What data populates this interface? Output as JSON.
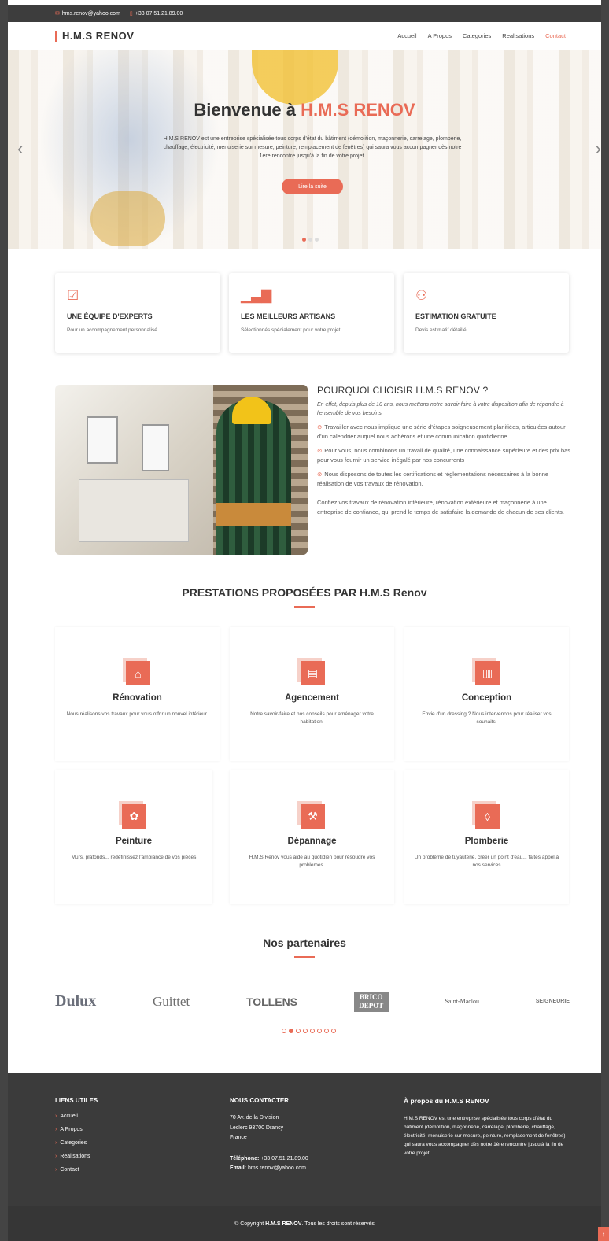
{
  "topbar": {
    "email": "hms.renov@yahoo.com",
    "phone": "+33 07.51.21.89.00"
  },
  "brand": {
    "name": "H.M.S RENOV",
    "accent": "#e96b56",
    "dark": "#3b3b3b"
  },
  "nav": {
    "items": [
      "Accueil",
      "A Propos",
      "Categories",
      "Realisations",
      "Contact"
    ],
    "active": "Contact"
  },
  "hero": {
    "title_prefix": "Bienvenue à",
    "title_accent": "H.M.S RENOV",
    "text": "H.M.S RENOV est une entreprise spécialisée tous corps d'état du bâtiment (démolition, maçonnerie, carrelage, plomberie, chauffage, électricité, menuiserie sur mesure, peinture, remplacement de fenêtres) qui saura vous accompagner dès notre 1ère rencontre jusqu'à la fin de votre projet.",
    "button": "Lire la suite",
    "prev_icon": "chevron-left-icon",
    "next_icon": "chevron-right-icon"
  },
  "features": [
    {
      "icon": "checklist-icon",
      "title": "UNE ÉQUIPE D'EXPERTS",
      "text": "Pour un accompagnement personnalisé"
    },
    {
      "icon": "bar-chart-icon",
      "title": "LES MEILLEURS ARTISANS",
      "text": "Sélectionnés spécialement pour votre projet"
    },
    {
      "icon": "binoculars-icon",
      "title": "ESTIMATION GRATUITE",
      "text": "Devis estimatif détaillé"
    }
  ],
  "why": {
    "title": "POURQUOI CHOISIR H.M.S RENOV ?",
    "lead": "En effet, depuis plus de 10 ans, nous mettons notre savoir-faire à votre disposition afin de répondre à l'ensemble de vos besoins.",
    "points": [
      "Travailler avec nous implique une série d'étapes soigneusement planifiées, articulées autour d'un calendrier auquel nous adhérons et une communication quotidienne.",
      "Pour vous, nous combinons un travail de qualité, une connaissance supérieure et des prix bas pour vous fournir un service inégalé par nos concurrents",
      "Nous disposons de toutes les certifications et réglementations nécessaires à la bonne réalisation de vos travaux de rénovation."
    ],
    "closing": "Confiez vos travaux de rénovation intérieure, rénovation extérieure et maçonnerie à une entreprise de confiance, qui prend le temps de satisfaire la demande de chacun de ses clients."
  },
  "services": {
    "title": "PRESTATIONS PROPOSÉES PAR H.M.S Renov",
    "items": [
      {
        "icon": "home-icon",
        "title": "Rénovation",
        "text": "Nous réalisons vos travaux pour vous offrir un nouvel intérieur."
      },
      {
        "icon": "document-icon",
        "title": "Agencement",
        "text": "Notre savoir-faire et nos conseils pour aménager votre habitation."
      },
      {
        "icon": "building-icon",
        "title": "Conception",
        "text": "Envie d'un dressing ? Nous intervenons pour réaliser vos souhaits."
      },
      {
        "icon": "palette-icon",
        "title": "Peinture",
        "text": "Murs, plafonds... redéfinissez l'ambiance de vos pièces"
      },
      {
        "icon": "hammer-icon",
        "title": "Dépannage",
        "text": "H.M.S Renov vous aide au quotidien pour résoudre vos problèmes."
      },
      {
        "icon": "drop-icon",
        "title": "Plomberie",
        "text": "Un problème de tuyauterie, créer un point d'eau... faites appel à nos services"
      }
    ]
  },
  "partners": {
    "title": "Nos partenaires",
    "logos": [
      "Dulux",
      "Guittet",
      "TOLLENS",
      "BRICO DEPOT",
      "Saint-Maclou",
      "SEIGNEURIE"
    ],
    "active_dot": 2,
    "dot_count": 8
  },
  "footer": {
    "links_title": "LIENS UTILES",
    "links": [
      "Accueil",
      "A Propos",
      "Categories",
      "Realisations",
      "Contact"
    ],
    "contact_title": "NOUS CONTACTER",
    "address": [
      "70 Av. de la Division",
      "Leclerc 93700 Drancy",
      "France"
    ],
    "phone_label": "Téléphone:",
    "phone": "+33 07.51.21.89.00",
    "email_label": "Email:",
    "email": "hms.renov@yahoo.com",
    "about_title": "À propos du H.M.S RENOV",
    "about_text": "H.M.S RENOV est une entreprise spécialisée tous corps d'état du bâtiment (démolition, maçonnerie, carrelage, plomberie, chauffage, électricité, menuiserie sur mesure, peinture, remplacement de fenêtres) qui saura vous accompagner dès notre 1ère rencontre jusqu'à la fin de votre projet.",
    "copyright_prefix": "© Copyright",
    "copyright_brand": "H.M.S RENOV",
    "copyright_suffix": ". Tous les droits sont réservés"
  }
}
